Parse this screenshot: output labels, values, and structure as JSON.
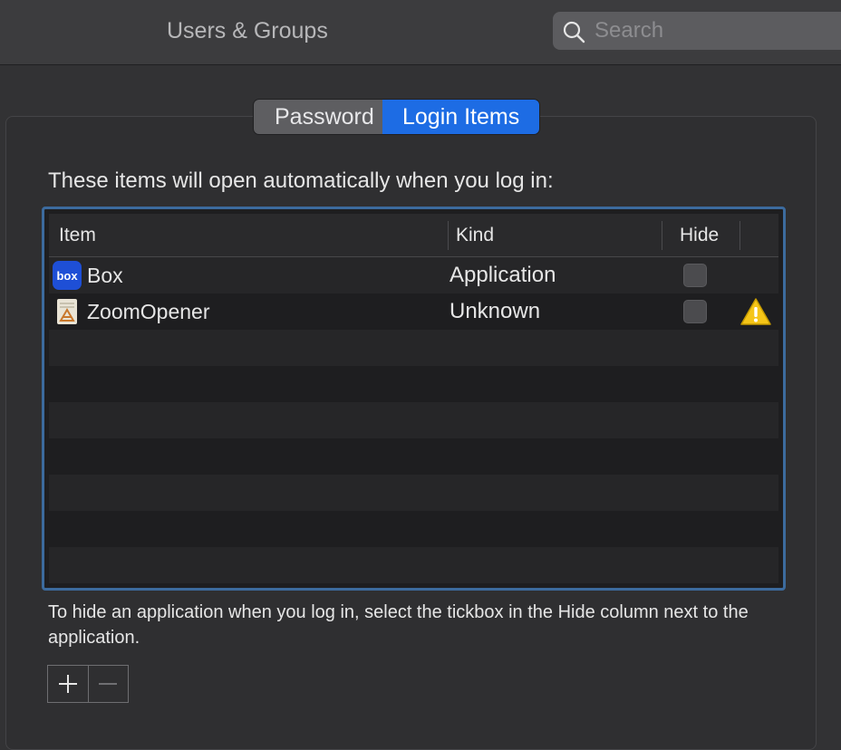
{
  "window": {
    "title": "Users & Groups"
  },
  "search": {
    "placeholder": "Search"
  },
  "tabs": [
    {
      "label": "Password",
      "active": false
    },
    {
      "label": "Login Items",
      "active": true
    }
  ],
  "intro_text": "These items will open automatically when you log in:",
  "table": {
    "columns": [
      "Item",
      "Kind",
      "Hide"
    ],
    "rows": [
      {
        "name": "Box",
        "kind": "Application",
        "hide": false,
        "icon": "box-app-icon",
        "warning": false
      },
      {
        "name": "ZoomOpener",
        "kind": "Unknown",
        "hide": false,
        "icon": "generic-app-icon",
        "warning": true
      }
    ]
  },
  "help_text": "To hide an application when you log in, select the tickbox in the Hide column next to the application.",
  "buttons": {
    "add": "plus-icon",
    "remove": "minus-icon"
  },
  "colors": {
    "accent": "#1d6ce4",
    "selection_border": "#3c6b9e",
    "warning": "#f5c518"
  }
}
